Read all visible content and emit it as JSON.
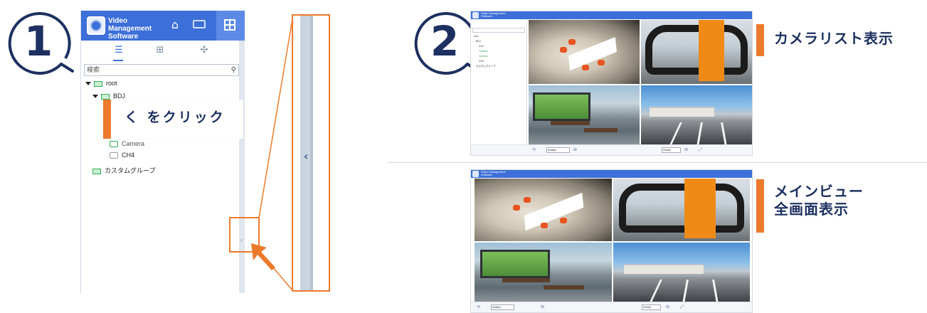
{
  "steps": {
    "step1": "1",
    "step2": "2"
  },
  "app": {
    "title_line1": "Video Management",
    "title_line2": "Software"
  },
  "sidebar": {
    "search_placeholder": "検索",
    "tree": [
      {
        "label": "root",
        "type": "folder"
      },
      {
        "label": "BDJ",
        "type": "nvr"
      },
      {
        "label": "Camera",
        "type": "camera"
      },
      {
        "label": "CH4",
        "type": "camera"
      },
      {
        "label": "カスタムグループ",
        "type": "group"
      }
    ]
  },
  "callouts": {
    "click_instruction": "く をクリック",
    "camera_list_view": "カメラリスト表示",
    "main_view_line1": "メインビュー",
    "main_view_line2": "全画面表示"
  },
  "mini_screen": {
    "tree_items": [
      "root",
      "BDJ",
      "CH1",
      "Camera",
      "Camera",
      "CH4",
      "カスタムグループ"
    ],
    "layout_select": "Multiple",
    "stream_select": "Default"
  },
  "icons": [
    "home-icon",
    "keyboard-icon",
    "grid-view-icon",
    "device-list-icon",
    "layout-icon",
    "ptz-icon",
    "search-icon",
    "collapse-chevron-icon",
    "camera-icon"
  ],
  "colors": {
    "accent_orange": "#ec7a2c",
    "header_blue": "#3c6fd8",
    "text_navy": "#1d3060"
  }
}
